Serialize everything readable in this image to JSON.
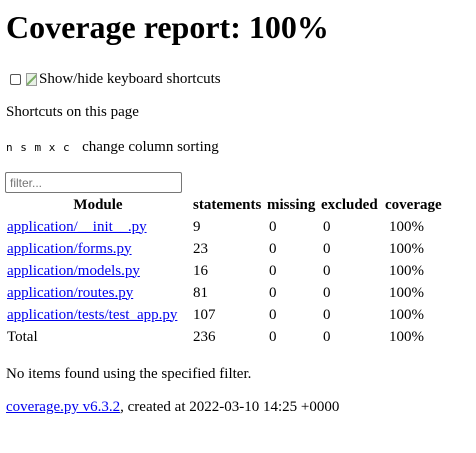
{
  "header": {
    "title": "Coverage report: 100%"
  },
  "keyboard": {
    "checkbox_checked": false,
    "image_alt": "Show/hide keyboard shortcuts"
  },
  "shortcuts": {
    "title": "Shortcuts on this page",
    "keys": "n s m x c",
    "description": "change column sorting"
  },
  "filter": {
    "placeholder": "filter...",
    "value": ""
  },
  "table": {
    "headers": {
      "module": "Module",
      "statements": "statements",
      "missing": "missing",
      "excluded": "excluded",
      "coverage": "coverage"
    },
    "rows": [
      {
        "module": "application/__init__.py",
        "statements": "9",
        "missing": "0",
        "excluded": "0",
        "coverage": "100%"
      },
      {
        "module": "application/forms.py",
        "statements": "23",
        "missing": "0",
        "excluded": "0",
        "coverage": "100%"
      },
      {
        "module": "application/models.py",
        "statements": "16",
        "missing": "0",
        "excluded": "0",
        "coverage": "100%"
      },
      {
        "module": "application/routes.py",
        "statements": "81",
        "missing": "0",
        "excluded": "0",
        "coverage": "100%"
      },
      {
        "module": "application/tests/test_app.py",
        "statements": "107",
        "missing": "0",
        "excluded": "0",
        "coverage": "100%"
      }
    ],
    "total": {
      "module": "Total",
      "statements": "236",
      "missing": "0",
      "excluded": "0",
      "coverage": "100%"
    }
  },
  "no_items_message": "No items found using the specified filter.",
  "footer": {
    "link_text": "coverage.py v6.3.2",
    "suffix": ", created at 2022-03-10 14:25 +0000"
  },
  "colors": {
    "link": "#0000ee",
    "text": "#000000",
    "background": "#ffffff"
  }
}
